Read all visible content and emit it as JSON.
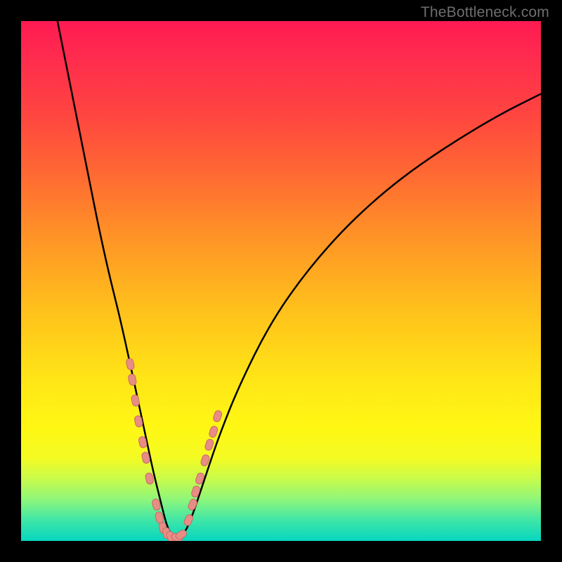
{
  "watermark": "TheBottleneck.com",
  "colors": {
    "curve": "#000000",
    "markers_fill": "#e88d86",
    "markers_stroke": "#c76a63",
    "frame": "#000000"
  },
  "chart_data": {
    "type": "line",
    "title": "",
    "xlabel": "",
    "ylabel": "",
    "xlim": [
      0,
      100
    ],
    "ylim": [
      0,
      100
    ],
    "grid": false,
    "legend": false,
    "series": [
      {
        "name": "bottleneck-curve",
        "x": [
          7,
          9,
          11,
          13,
          15,
          17,
          19,
          21,
          22.5,
          24,
          25.5,
          27,
          28,
          29,
          30,
          31.5,
          33,
          35,
          38,
          42,
          48,
          55,
          63,
          72,
          82,
          92,
          100
        ],
        "y": [
          100,
          90,
          80,
          70,
          60,
          51,
          43,
          34,
          27,
          20,
          13,
          7,
          3,
          1,
          0.5,
          1.5,
          5,
          11,
          20,
          30,
          42,
          52,
          61,
          69,
          76,
          82,
          86
        ]
      }
    ],
    "markers": [
      {
        "name": "cluster-left",
        "x": [
          21.0,
          21.4,
          22.0,
          22.6,
          23.4,
          24.0,
          24.7,
          26.0,
          26.6,
          27.3
        ],
        "y": [
          34,
          31,
          27,
          23,
          19,
          16,
          12,
          7,
          4.5,
          2.5
        ]
      },
      {
        "name": "cluster-min",
        "x": [
          28.0,
          28.8,
          30.0,
          30.8
        ],
        "y": [
          1.5,
          0.8,
          0.6,
          1.2
        ]
      },
      {
        "name": "cluster-right",
        "x": [
          32.2,
          33.0,
          33.6,
          34.4,
          35.4,
          36.2,
          37.0,
          37.8
        ],
        "y": [
          4,
          7,
          9.5,
          12,
          15.5,
          18.5,
          21,
          24
        ]
      }
    ]
  }
}
